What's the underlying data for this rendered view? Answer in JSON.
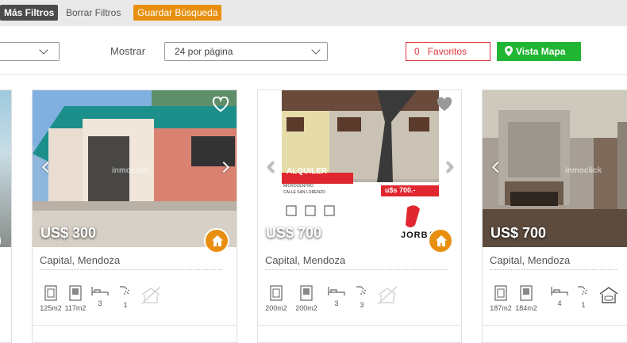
{
  "topbar": {
    "mas_filtros": "Más Filtros",
    "borrar_filtros": "Borrar Filtros",
    "guardar_busqueda": "Guardar Búsqueda"
  },
  "filters": {
    "mostrar_label": "Mostrar",
    "per_page": "24 por página",
    "favoritos_count": "0",
    "favoritos_label": "Favoritos",
    "vista_mapa": "Vista Mapa"
  },
  "cards": [
    {
      "price": "US$ 300",
      "location": "Capital, Mendoza",
      "watermark": "inmoclick",
      "features": [
        "125m2",
        "117m2",
        "3",
        "1"
      ]
    },
    {
      "price": "US$ 700",
      "location": "Capital, Mendoza",
      "banner": {
        "tag": "ALQUILER",
        "zone": "MICROCENTRO",
        "street": "CALLE SAN LORENZO",
        "amount": "u$s 700.-",
        "brand": "JORBA"
      },
      "features": [
        "200m2",
        "200m2",
        "3",
        "3"
      ]
    },
    {
      "price": "US$ 700",
      "location": "Capital, Mendoza",
      "watermark": "inmoclick",
      "features": [
        "187m2",
        "184m2",
        "4",
        "1"
      ]
    }
  ],
  "colors": {
    "orange": "#e88f10",
    "green": "#21b534",
    "red": "#e3383e",
    "dark": "#4a4a4a"
  }
}
